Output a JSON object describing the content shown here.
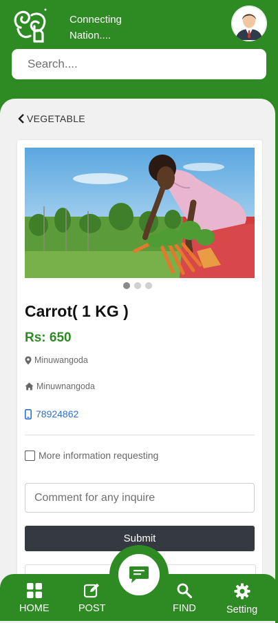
{
  "header": {
    "tagline_line1": "Connecting",
    "tagline_line2": "Nation....",
    "brand_color": "#2e8a23"
  },
  "search": {
    "placeholder": "Search...."
  },
  "breadcrumb": {
    "label": "VEGETABLE"
  },
  "product": {
    "carousel": {
      "slide_count": 3,
      "active_index": 0
    },
    "title": "Carrot( 1 KG )",
    "price": "Rs: 650",
    "location": "Minuwangoda",
    "address": "Minuwnangoda",
    "phone": "78924862",
    "more_info_label": "More information requesting",
    "comment_placeholder": "Comment for any inquire",
    "submit_label": "Submit"
  },
  "bottom_nav": {
    "home": "HOME",
    "post": "POST",
    "find": "FIND",
    "setting": "Setting",
    "center_icon": "chat-icon"
  },
  "icons": {
    "back": "chevron-left-icon",
    "location": "map-pin-icon",
    "address": "home-icon",
    "phone": "mobile-phone-icon"
  }
}
